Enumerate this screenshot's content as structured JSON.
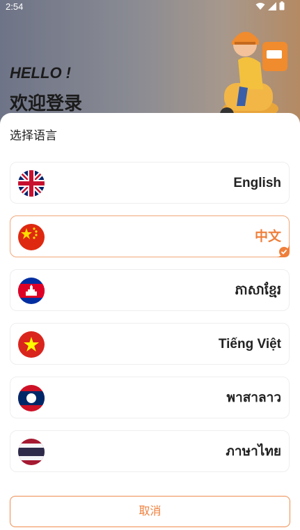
{
  "status_bar": {
    "time": "2:54"
  },
  "hero": {
    "greeting": "HELLO !",
    "welcome": "欢迎登录"
  },
  "sheet": {
    "title": "选择语言",
    "languages": [
      {
        "label": "English",
        "flag": "uk-flag-icon",
        "selected": false
      },
      {
        "label": "中文",
        "flag": "china-flag-icon",
        "selected": true
      },
      {
        "label": "ភាសាខ្មែរ",
        "flag": "cambodia-flag-icon",
        "selected": false
      },
      {
        "label": "Tiếng Việt",
        "flag": "vietnam-flag-icon",
        "selected": false
      },
      {
        "label": "พาสาลาว",
        "flag": "laos-flag-icon",
        "selected": false
      },
      {
        "label": "ภาษาไทย",
        "flag": "thailand-flag-icon",
        "selected": false
      }
    ],
    "cancel_label": "取消"
  },
  "colors": {
    "accent": "#ef7f3a",
    "selected_border": "#f0a77a"
  }
}
